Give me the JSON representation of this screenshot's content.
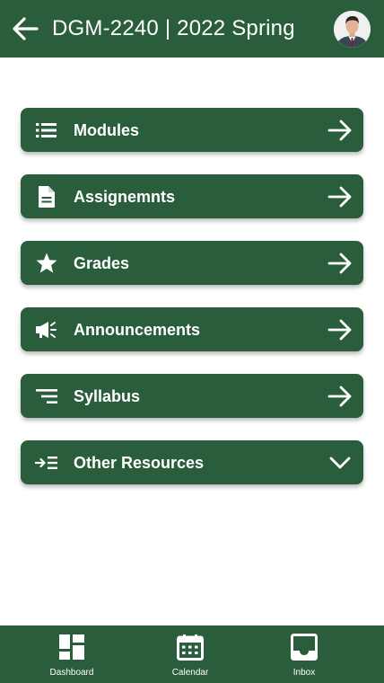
{
  "header": {
    "title": "DGM-2240 | 2022 Spring",
    "back_icon": "arrow-left-icon",
    "avatar_icon": "user-avatar"
  },
  "menu": {
    "items": [
      {
        "label": "Modules",
        "icon": "list-icon",
        "action_icon": "arrow-right-icon"
      },
      {
        "label": "Assignemnts",
        "icon": "document-icon",
        "action_icon": "arrow-right-icon"
      },
      {
        "label": "Grades",
        "icon": "star-icon",
        "action_icon": "arrow-right-icon"
      },
      {
        "label": "Announcements",
        "icon": "megaphone-icon",
        "action_icon": "arrow-right-icon"
      },
      {
        "label": "Syllabus",
        "icon": "sort-lines-icon",
        "action_icon": "arrow-right-icon"
      },
      {
        "label": "Other Resources",
        "icon": "indent-icon",
        "action_icon": "chevron-down-icon"
      }
    ]
  },
  "bottom_nav": {
    "items": [
      {
        "label": "Dashboard",
        "icon": "dashboard-icon"
      },
      {
        "label": "Calendar",
        "icon": "calendar-icon"
      },
      {
        "label": "Inbox",
        "icon": "inbox-icon"
      }
    ]
  },
  "colors": {
    "brand_green": "#2a5d3b",
    "text_on_brand": "#ffffff",
    "background": "#ffffff"
  }
}
